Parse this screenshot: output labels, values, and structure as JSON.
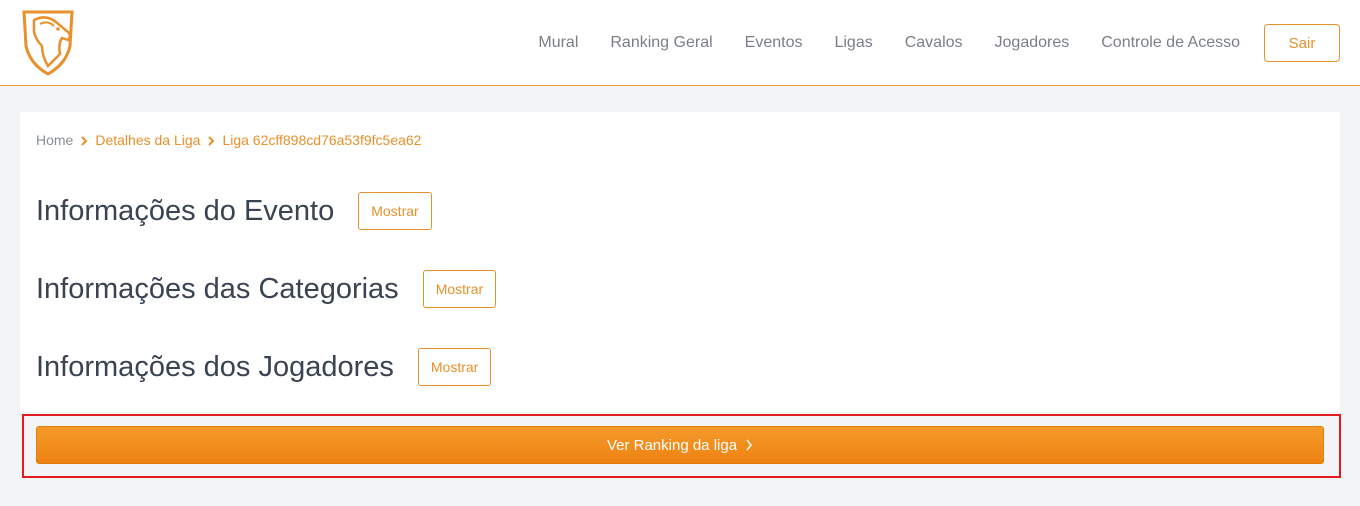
{
  "navbar": {
    "links": [
      "Mural",
      "Ranking Geral",
      "Eventos",
      "Ligas",
      "Cavalos",
      "Jogadores",
      "Controle de Acesso"
    ],
    "logout_label": "Sair"
  },
  "breadcrumb": {
    "home": "Home",
    "league_details": "Detalhes da Liga",
    "league_id": "Liga 62cff898cd76a53f9fc5ea62"
  },
  "sections": [
    {
      "title": "Informações do Evento",
      "button": "Mostrar"
    },
    {
      "title": "Informações das Categorias",
      "button": "Mostrar"
    },
    {
      "title": "Informações dos Jogadores",
      "button": "Mostrar"
    }
  ],
  "ranking_button": {
    "label": "Ver Ranking da liga"
  },
  "colors": {
    "accent": "#e8902a",
    "highlight": "#e01b22",
    "text": "#3a4352"
  }
}
